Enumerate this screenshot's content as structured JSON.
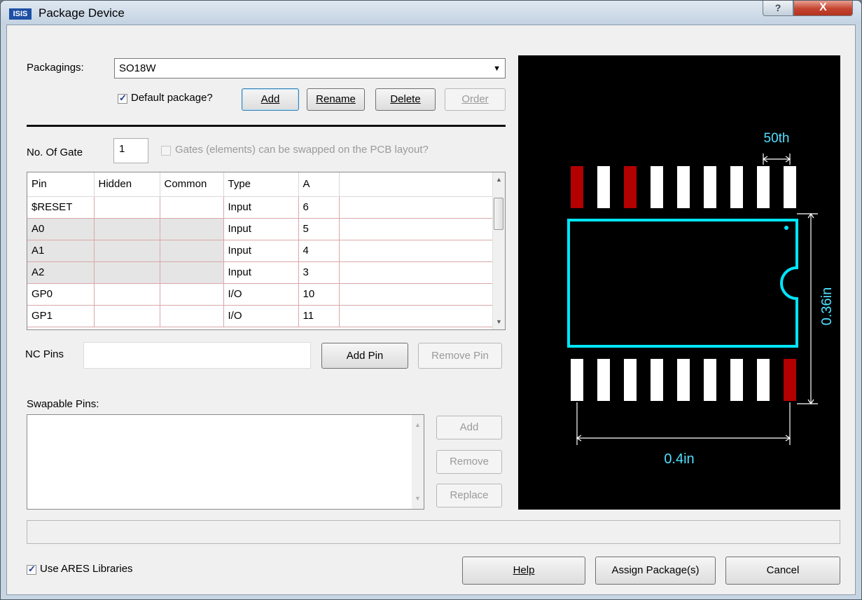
{
  "window": {
    "title": "Package Device",
    "app_icon_text": "ISIS",
    "help_glyph": "?",
    "close_glyph": "X"
  },
  "packagings": {
    "label": "Packagings:",
    "selected": "SO18W"
  },
  "default_package": {
    "label": "Default package?",
    "checked": true
  },
  "buttons": {
    "add": "Add",
    "rename": "Rename",
    "delete": "Delete",
    "order": "Order",
    "add_pin": "Add Pin",
    "remove_pin": "Remove Pin",
    "swap_add": "Add",
    "swap_remove": "Remove",
    "swap_replace": "Replace",
    "help": "Help",
    "assign": "Assign Package(s)",
    "cancel": "Cancel"
  },
  "gates": {
    "label": "No. Of Gate",
    "value": "1",
    "swap_label": "Gates (elements) can be swapped on the PCB layout?",
    "swap_checked": false
  },
  "pin_table": {
    "headers": [
      "Pin",
      "Hidden",
      "Common",
      "Type",
      "A",
      ""
    ],
    "rows": [
      [
        "$RESET",
        "",
        "",
        "Input",
        "6",
        ""
      ],
      [
        "A0",
        "",
        "",
        "Input",
        "5",
        ""
      ],
      [
        "A1",
        "",
        "",
        "Input",
        "4",
        ""
      ],
      [
        "A2",
        "",
        "",
        "Input",
        "3",
        ""
      ],
      [
        "GP0",
        "",
        "",
        "I/O",
        "10",
        ""
      ],
      [
        "GP1",
        "",
        "",
        "I/O",
        "11",
        ""
      ]
    ]
  },
  "nc_pins": {
    "label": "NC Pins",
    "value": ""
  },
  "swapable": {
    "label": "Swapable Pins:"
  },
  "use_ares": {
    "label": "Use ARES Libraries",
    "checked": true
  },
  "preview": {
    "dim_pitch": "50th",
    "dim_height": "0.36in",
    "dim_width": "0.4in",
    "colors": {
      "background": "#000000",
      "outline": "#00e5ff",
      "pad": "#ffffff",
      "pad_highlight": "#b30000",
      "dimension": "#ffffff",
      "dimension_text": "#4fe0ff"
    }
  }
}
